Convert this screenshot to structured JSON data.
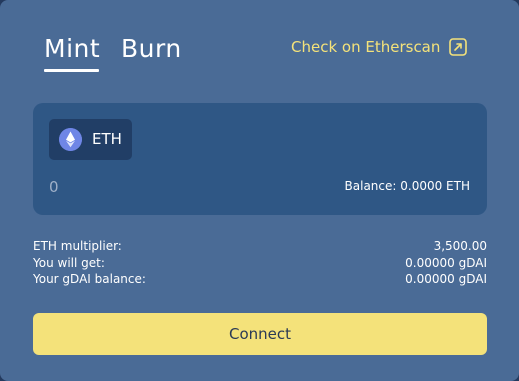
{
  "tabs": {
    "mint": "Mint",
    "burn": "Burn",
    "active": "Mint"
  },
  "etherscan_link": {
    "label": "Check on Etherscan",
    "icon": "external-link-icon"
  },
  "token": {
    "symbol": "ETH",
    "icon": "ethereum-icon"
  },
  "amount_input": {
    "placeholder": "0"
  },
  "balance": "Balance: 0.0000 ETH",
  "info": [
    {
      "label": "ETH multiplier:",
      "value": "3,500.00"
    },
    {
      "label": "You will get:",
      "value": "0.00000 gDAI"
    },
    {
      "label": "Your gDAI balance:",
      "value": "0.00000 gDAI"
    }
  ],
  "connect_label": "Connect",
  "colors": {
    "card": "#4a6b96",
    "panel": "#2f5785",
    "accent_yellow": "#f4e27a",
    "token_pill": "#213e66"
  }
}
